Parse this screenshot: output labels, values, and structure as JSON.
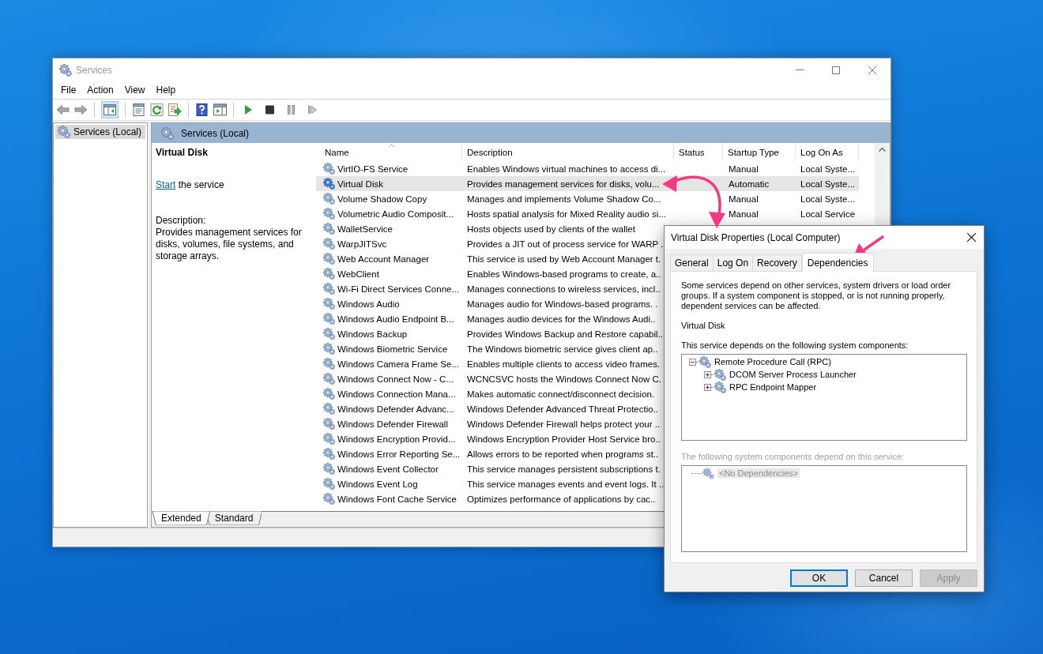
{
  "main_window": {
    "title": "Services",
    "active": false,
    "menu": [
      "File",
      "Action",
      "View",
      "Help"
    ],
    "toolbar": {
      "tree_toggle": {
        "pressed": true
      }
    },
    "tree": [
      {
        "label": "Services (Local)",
        "selected": true
      }
    ],
    "pane_header": "Services (Local)",
    "detail": {
      "title": "Virtual Disk",
      "action_link": "Start",
      "action_text": "the service",
      "description_label": "Description:",
      "description": "Provides management services for disks, volumes, file systems, and storage arrays."
    },
    "table": {
      "columns": [
        {
          "label": "Name",
          "sorted": true
        },
        {
          "label": "Description"
        },
        {
          "label": "Status"
        },
        {
          "label": "Startup Type"
        },
        {
          "label": "Log On As"
        }
      ],
      "rows": [
        {
          "name": "VirtIO-FS Service",
          "description": "Enables Windows virtual machines to access di...",
          "startup_type": "Manual",
          "log_on_as": "Local Syste...",
          "selected": false
        },
        {
          "name": "Virtual Disk",
          "description": "Provides management services for disks, volu...",
          "startup_type": "Automatic",
          "log_on_as": "Local Syste...",
          "selected": true
        },
        {
          "name": "Volume Shadow Copy",
          "description": "Manages and implements Volume Shadow Co...",
          "startup_type": "Manual",
          "log_on_as": "Local Syste...",
          "selected": false
        },
        {
          "name": "Volumetric Audio Composit...",
          "description": "Hosts spatial analysis for Mixed Reality audio si...",
          "startup_type": "Manual",
          "log_on_as": "Local Service",
          "selected": false
        },
        {
          "name": "WalletService",
          "description": "Hosts objects used by clients of the wallet",
          "selected": false
        },
        {
          "name": "WarpJITSvc",
          "description": "Provides a JIT out of process service for WARP ..",
          "selected": false
        },
        {
          "name": "Web Account Manager",
          "description": "This service is used by Web Account Manager t.",
          "selected": false
        },
        {
          "name": "WebClient",
          "description": "Enables Windows-based programs to create, a..",
          "selected": false
        },
        {
          "name": "Wi-Fi Direct Services Conne...",
          "description": "Manages connections to wireless services, incl..",
          "selected": false
        },
        {
          "name": "Windows Audio",
          "description": "Manages audio for Windows-based programs. .",
          "selected": false
        },
        {
          "name": "Windows Audio Endpoint B...",
          "description": "Manages audio devices for the Windows Audi..",
          "selected": false
        },
        {
          "name": "Windows Backup",
          "description": "Provides Windows Backup and Restore capabil..",
          "selected": false
        },
        {
          "name": "Windows Biometric Service",
          "description": "The Windows biometric service gives client ap..",
          "selected": false
        },
        {
          "name": "Windows Camera Frame Se...",
          "description": "Enables multiple clients to access video frames.",
          "selected": false
        },
        {
          "name": "Windows Connect Now - C...",
          "description": "WCNCSVC hosts the Windows Connect Now C.",
          "selected": false
        },
        {
          "name": "Windows Connection Mana...",
          "description": "Makes automatic connect/disconnect decision.",
          "selected": false
        },
        {
          "name": "Windows Defender Advanc...",
          "description": "Windows Defender Advanced Threat Protectio..",
          "selected": false
        },
        {
          "name": "Windows Defender Firewall",
          "description": "Windows Defender Firewall helps protect your ..",
          "selected": false
        },
        {
          "name": "Windows Encryption Provid...",
          "description": "Windows Encryption Provider Host Service bro..",
          "selected": false
        },
        {
          "name": "Windows Error Reporting Se...",
          "description": "Allows errors to be reported when programs st..",
          "selected": false
        },
        {
          "name": "Windows Event Collector",
          "description": "This service manages persistent subscriptions t.",
          "selected": false
        },
        {
          "name": "Windows Event Log",
          "description": "This service manages events and event logs. It ..",
          "selected": false
        },
        {
          "name": "Windows Font Cache Service",
          "description": "Optimizes performance of applications by cac..",
          "selected": false
        }
      ]
    },
    "view_tabs": [
      {
        "label": "Extended",
        "selected": true
      },
      {
        "label": "Standard",
        "selected": false
      }
    ]
  },
  "dialog": {
    "title": "Virtual Disk Properties (Local Computer)",
    "active": true,
    "tabs": [
      {
        "label": "General",
        "selected": false
      },
      {
        "label": "Log On",
        "selected": false
      },
      {
        "label": "Recovery",
        "selected": false
      },
      {
        "label": "Dependencies",
        "selected": true
      }
    ],
    "intro": "Some services depend on other services, system drivers or load order groups. If a system component is stopped, or is not running properly, dependent services can be affected.",
    "service_name": "Virtual Disk",
    "depends_on_label": "This service depends on the following system components:",
    "depends_on": [
      {
        "label": "Remote Procedure Call (RPC)",
        "expanded": true,
        "children": [
          {
            "label": "DCOM Server Process Launcher",
            "expanded": false
          },
          {
            "label": "RPC Endpoint Mapper",
            "expanded": false
          }
        ]
      }
    ],
    "dependents": {
      "label": "The following system components depend on this service:",
      "disabled": true,
      "items": [
        {
          "label": "<No Dependencies>",
          "selected": true
        }
      ]
    },
    "buttons": [
      {
        "label": "OK",
        "default": true,
        "disabled": false
      },
      {
        "label": "Cancel",
        "default": false,
        "disabled": false
      },
      {
        "label": "Apply",
        "default": false,
        "disabled": true
      }
    ]
  }
}
